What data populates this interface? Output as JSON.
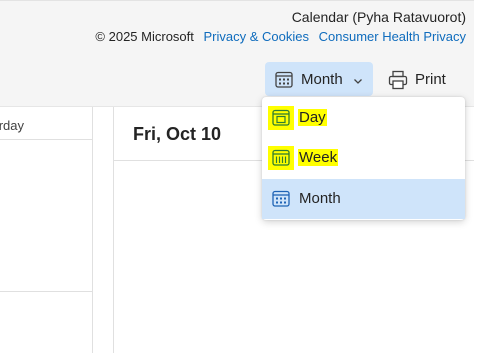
{
  "header": {
    "calendar_title": "Calendar (Pyha Ratavuorot)",
    "copyright": "© 2025 Microsoft",
    "links": [
      "Privacy & Cookies",
      "Consumer Health Privacy"
    ]
  },
  "toolbar": {
    "view_label": "Month",
    "print_label": "Print"
  },
  "left_column": {
    "header_text": "rday"
  },
  "day_column": {
    "date": "Fri, Oct 10"
  },
  "view_menu": {
    "items": [
      {
        "label": "Day",
        "icon": "calendar-day-icon",
        "highlighted": true
      },
      {
        "label": "Week",
        "icon": "calendar-week-icon",
        "highlighted": true
      },
      {
        "label": "Month",
        "icon": "calendar-month-icon",
        "selected": true
      }
    ]
  },
  "colors": {
    "accent": "#0f6cbd",
    "selected_bg": "#cfe4fa",
    "highlight": "#ffff00"
  }
}
